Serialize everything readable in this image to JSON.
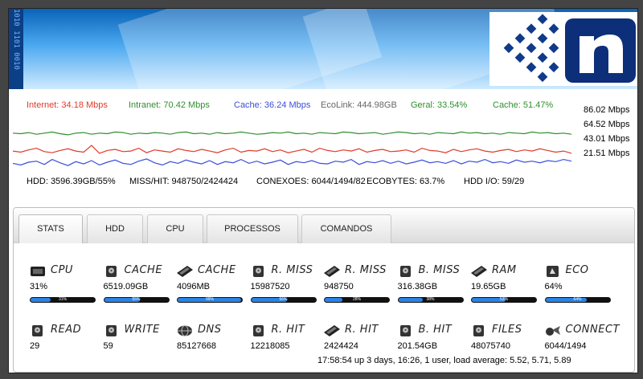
{
  "legend": [
    {
      "label": "Internet: 34.18 Mbps",
      "color": "#e03a2a"
    },
    {
      "label": "Intranet: 70.42 Mbps",
      "color": "#2f8f2f"
    },
    {
      "label": "Cache: 36.24 Mbps",
      "color": "#3a4fd8"
    },
    {
      "label": "EcoLink: 444.98GB",
      "color": "#666666"
    },
    {
      "label": "Geral: 33.54%",
      "color": "#2f8f2f"
    },
    {
      "label": "Cache: 51.47%",
      "color": "#2f8f2f"
    }
  ],
  "scale": [
    "86.02 Mbps",
    "64.52 Mbps",
    "43.01 Mbps",
    "21.51 Mbps"
  ],
  "summary": {
    "hdd": "HDD: 3596.39GB/55%",
    "misshit": "MISS/HIT: 948750/2424424",
    "conexoes": "CONEXOES: 6044/1494/82",
    "ecobytes": "ECOBYTES: 63.7%",
    "hddio": "HDD I/O: 59/29"
  },
  "tabs": [
    "STATS",
    "HDD",
    "CPU",
    "PROCESSOS",
    "COMANDOS"
  ],
  "stats_row1": [
    {
      "label": "CPU",
      "value": "31%",
      "pct": "31%",
      "fill": 0.31,
      "icon": "cpu-icon"
    },
    {
      "label": "CACHE",
      "value": "6519.09GB",
      "pct": "55%",
      "fill": 0.55,
      "icon": "disk-icon"
    },
    {
      "label": "CACHE",
      "value": "4096MB",
      "pct": "99%",
      "fill": 0.99,
      "icon": "ram-icon"
    },
    {
      "label": "R. MISS",
      "value": "15987520",
      "pct": "56%",
      "fill": 0.56,
      "icon": "disk-icon"
    },
    {
      "label": "R. MISS",
      "value": "948750",
      "pct": "28%",
      "fill": 0.28,
      "icon": "ram-icon"
    },
    {
      "label": "B. MISS",
      "value": "316.38GB",
      "pct": "38%",
      "fill": 0.38,
      "icon": "disk-icon"
    },
    {
      "label": "RAM",
      "value": "19.65GB",
      "pct": "53%",
      "fill": 0.53,
      "icon": "ram-icon"
    },
    {
      "label": "ECO",
      "value": "64%",
      "pct": "64%",
      "fill": 0.64,
      "icon": "eco-icon"
    }
  ],
  "stats_row2": [
    {
      "label": "READ",
      "value": "29",
      "icon": "disk-icon"
    },
    {
      "label": "WRITE",
      "value": "59",
      "icon": "disk-icon"
    },
    {
      "label": "DNS",
      "value": "85127668",
      "icon": "globe-icon"
    },
    {
      "label": "R. HIT",
      "value": "12218085",
      "icon": "disk-icon"
    },
    {
      "label": "R. HIT",
      "value": "2424424",
      "icon": "ram-icon"
    },
    {
      "label": "B. HIT",
      "value": "201.54GB",
      "icon": "disk-icon"
    },
    {
      "label": "FILES",
      "value": "48075740",
      "icon": "disk-icon"
    },
    {
      "label": "CONNECT",
      "value": "6044/1494",
      "icon": "connect-icon"
    }
  ],
  "uptime": "17:58:54 up 3 days, 16:26, 1 user, load average: 5.52, 5.71, 5.89",
  "chart_data": {
    "type": "line",
    "ylim": [
      0,
      107.5
    ],
    "grid": false,
    "series": [
      {
        "name": "Intranet",
        "color": "#2f8f2f",
        "values": [
          72,
          71,
          73,
          70,
          72,
          74,
          71,
          69,
          72,
          73,
          70,
          72,
          71,
          74,
          73,
          70,
          72,
          71,
          73,
          72,
          70,
          73,
          74,
          71,
          72,
          70,
          73,
          71,
          72,
          74,
          72,
          70,
          71,
          73,
          72,
          74,
          71,
          72,
          70,
          73,
          72,
          71,
          74,
          73,
          71,
          72,
          73,
          70,
          72,
          74,
          73,
          71,
          72,
          70,
          73,
          72,
          71,
          74,
          72,
          73,
          71,
          72,
          70,
          73,
          72,
          71,
          74,
          72,
          73,
          71,
          72,
          70
        ]
      },
      {
        "name": "Internet",
        "color": "#e03a2a",
        "values": [
          40,
          38,
          42,
          45,
          39,
          37,
          41,
          44,
          40,
          38,
          50,
          36,
          41,
          43,
          39,
          40,
          45,
          37,
          42,
          40,
          38,
          44,
          41,
          39,
          43,
          40,
          37,
          42,
          45,
          38,
          41,
          40,
          44,
          39,
          42,
          37,
          40,
          43,
          38,
          45,
          41,
          39,
          42,
          40,
          44,
          38,
          41,
          43,
          39,
          40,
          42,
          38,
          45,
          41,
          40,
          37,
          43,
          39,
          42,
          44,
          40,
          38,
          41,
          43,
          39,
          42,
          40,
          44,
          41,
          38,
          40,
          36
        ]
      },
      {
        "name": "Cache",
        "color": "#3a4fd8",
        "values": [
          18,
          15,
          20,
          22,
          16,
          25,
          19,
          14,
          21,
          17,
          23,
          15,
          20,
          24,
          18,
          16,
          22,
          26,
          19,
          15,
          21,
          18,
          24,
          20,
          17,
          23,
          16,
          21,
          19,
          25,
          18,
          22,
          17,
          20,
          24,
          16,
          21,
          19,
          23,
          18,
          17,
          22,
          20,
          25,
          16,
          21,
          19,
          23,
          18,
          22,
          17,
          20,
          24,
          19,
          21,
          18,
          23,
          17,
          22,
          20,
          25,
          19,
          21,
          18,
          24,
          20,
          22,
          19,
          23,
          21,
          25,
          22
        ]
      }
    ]
  }
}
